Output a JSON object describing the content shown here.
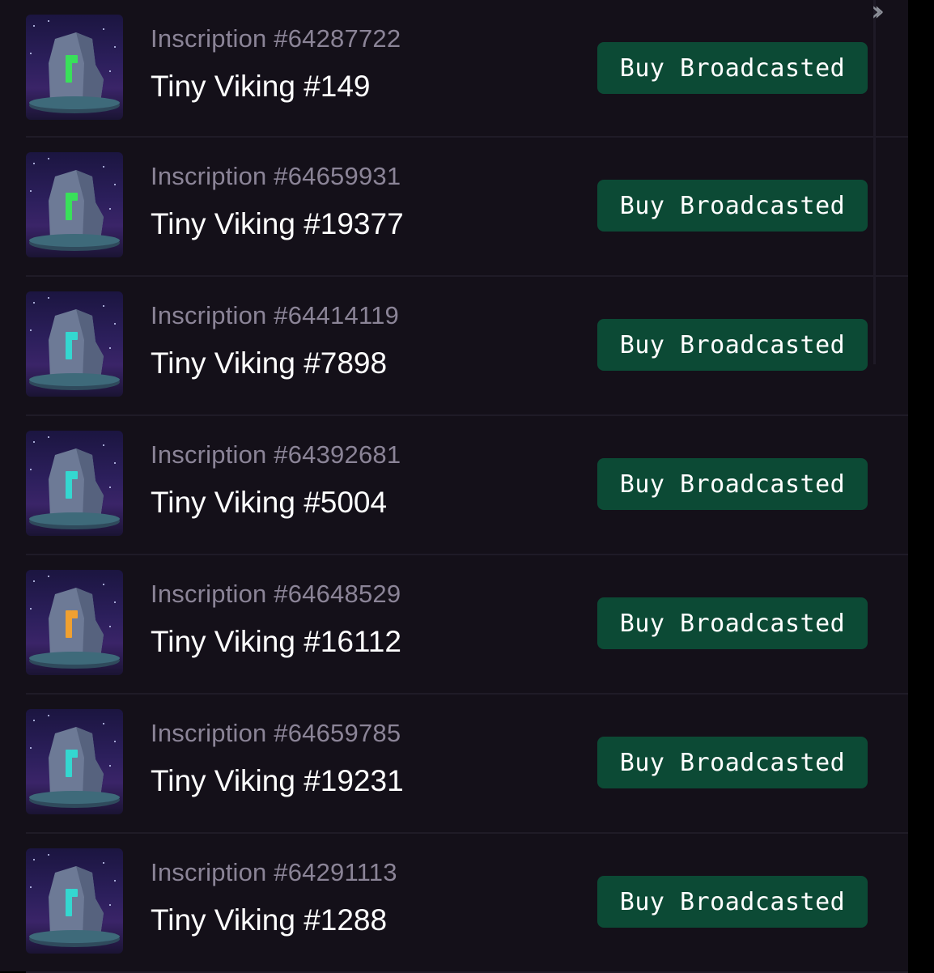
{
  "header": {
    "collapse_icon": "double-chevron-right-icon"
  },
  "items": [
    {
      "inscription": "Inscription #64287722",
      "name": "Tiny Viking #149",
      "button": "Buy Broadcasted",
      "rune_color": "#39e05a"
    },
    {
      "inscription": "Inscription #64659931",
      "name": "Tiny Viking #19377",
      "button": "Buy Broadcasted",
      "rune_color": "#39e05a"
    },
    {
      "inscription": "Inscription #64414119",
      "name": "Tiny Viking #7898",
      "button": "Buy Broadcasted",
      "rune_color": "#34d7d0"
    },
    {
      "inscription": "Inscription #64392681",
      "name": "Tiny Viking #5004",
      "button": "Buy Broadcasted",
      "rune_color": "#34d7d0"
    },
    {
      "inscription": "Inscription #64648529",
      "name": "Tiny Viking #16112",
      "button": "Buy Broadcasted",
      "rune_color": "#f0a030"
    },
    {
      "inscription": "Inscription #64659785",
      "name": "Tiny Viking #19231",
      "button": "Buy Broadcasted",
      "rune_color": "#34d7d0"
    },
    {
      "inscription": "Inscription #64291113",
      "name": "Tiny Viking #1288",
      "button": "Buy Broadcasted",
      "rune_color": "#34d7d0"
    }
  ],
  "colors": {
    "background": "#141019",
    "button": "#0c4a35",
    "subtitle": "#8b8497",
    "title": "#ffffff"
  }
}
